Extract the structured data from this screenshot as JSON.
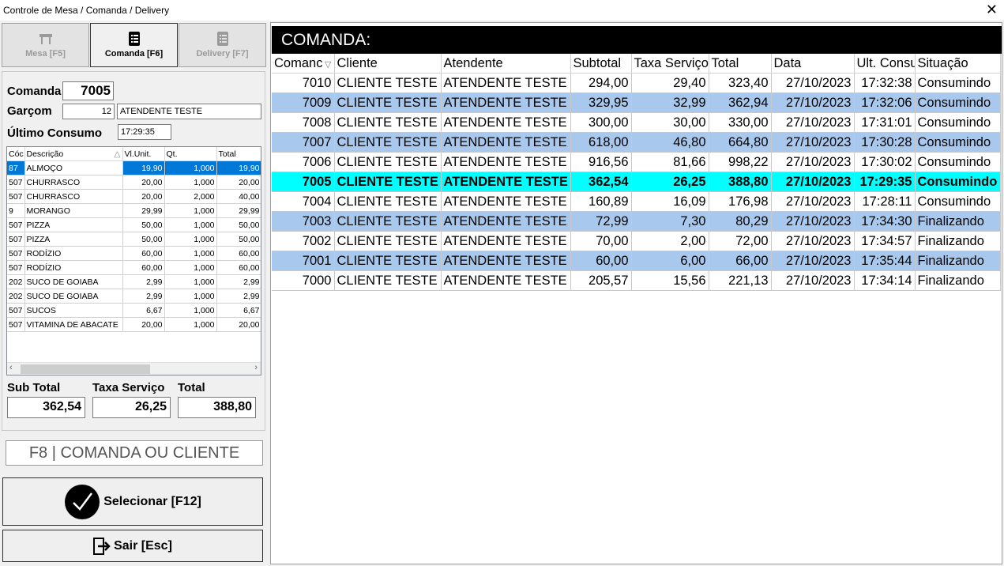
{
  "window": {
    "title": "Controle de Mesa / Comanda / Delivery",
    "close_glyph": "✕"
  },
  "tabs": [
    {
      "label": "Mesa [F5]",
      "icon": "table-icon",
      "active": false
    },
    {
      "label": "Comanda [F6]",
      "icon": "list-icon",
      "active": true
    },
    {
      "label": "Delivery [F7]",
      "icon": "list-icon",
      "active": false
    }
  ],
  "order": {
    "comanda_label": "Comanda",
    "comanda_value": "7005",
    "garcom_label": "Garçom",
    "garcom_code": "12",
    "garcom_name": "ATENDENTE TESTE",
    "ultimo_label": "Último Consumo",
    "ultimo_value": "17:29:35"
  },
  "items_grid": {
    "headers": {
      "code": "Cóc",
      "desc": "Descrição",
      "sort_glyph": "△",
      "unit": "Vl.Unit.",
      "qty": "Qt.",
      "total": "Total"
    },
    "rows": [
      {
        "code": "87",
        "desc": "ALMOÇO",
        "unit": "19,90",
        "qty": "1,000",
        "total": "19,90"
      },
      {
        "code": "507",
        "desc": "CHURRASCO",
        "unit": "20,00",
        "qty": "1,000",
        "total": "20,00"
      },
      {
        "code": "507",
        "desc": "CHURRASCO",
        "unit": "20,00",
        "qty": "2,000",
        "total": "40,00"
      },
      {
        "code": "9",
        "desc": "MORANGO",
        "unit": "29,99",
        "qty": "1,000",
        "total": "29,99"
      },
      {
        "code": "507",
        "desc": "PIZZA",
        "unit": "50,00",
        "qty": "1,000",
        "total": "50,00"
      },
      {
        "code": "507",
        "desc": "PIZZA",
        "unit": "50,00",
        "qty": "1,000",
        "total": "50,00"
      },
      {
        "code": "507",
        "desc": "RODÍZIO",
        "unit": "60,00",
        "qty": "1,000",
        "total": "60,00"
      },
      {
        "code": "507",
        "desc": "RODÍZIO",
        "unit": "60,00",
        "qty": "1,000",
        "total": "60,00"
      },
      {
        "code": "202",
        "desc": "SUCO DE GOIABA",
        "unit": "2,99",
        "qty": "1,000",
        "total": "2,99"
      },
      {
        "code": "202",
        "desc": "SUCO DE GOIABA",
        "unit": "2,99",
        "qty": "1,000",
        "total": "2,99"
      },
      {
        "code": "507",
        "desc": "SUCOS",
        "unit": "6,67",
        "qty": "1,000",
        "total": "6,67"
      },
      {
        "code": "507",
        "desc": "VITAMINA DE ABACATE",
        "unit": "20,00",
        "qty": "1,000",
        "total": "20,00"
      }
    ],
    "scroll_left": "‹",
    "scroll_right": "›"
  },
  "totals": {
    "subtotal_label": "Sub Total",
    "subtotal_value": "362,54",
    "taxa_label": "Taxa Serviço",
    "taxa_value": "26,25",
    "total_label": "Total",
    "total_value": "388,80"
  },
  "search": {
    "label": "F8 | COMANDA OU CLIENTE"
  },
  "buttons": {
    "select_label": "Selecionar [F12]",
    "exit_label": "Sair [Esc]"
  },
  "comandas": {
    "header_title": "COMANDA:",
    "columns": [
      "Comanc",
      "Cliente",
      "Atendente",
      "Subtotal",
      "Taxa Serviço",
      "Total",
      "Data",
      "Ult. Consu",
      "Situação"
    ],
    "sort_glyph": "▽",
    "highlight_color": "#00ffff",
    "alt_row_color": "#a8c8ee",
    "rows": [
      {
        "num": "7010",
        "cliente": "CLIENTE TESTE",
        "atendente": "ATENDENTE TESTE",
        "subtotal": "294,00",
        "taxa": "29,40",
        "total": "323,40",
        "data": "27/10/2023",
        "ult": "17:32:38",
        "situacao": "Consumindo"
      },
      {
        "num": "7009",
        "cliente": "CLIENTE TESTE",
        "atendente": "ATENDENTE TESTE",
        "subtotal": "329,95",
        "taxa": "32,99",
        "total": "362,94",
        "data": "27/10/2023",
        "ult": "17:32:06",
        "situacao": "Consumindo"
      },
      {
        "num": "7008",
        "cliente": "CLIENTE TESTE",
        "atendente": "ATENDENTE TESTE",
        "subtotal": "300,00",
        "taxa": "30,00",
        "total": "330,00",
        "data": "27/10/2023",
        "ult": "17:31:01",
        "situacao": "Consumindo"
      },
      {
        "num": "7007",
        "cliente": "CLIENTE TESTE",
        "atendente": "ATENDENTE TESTE",
        "subtotal": "618,00",
        "taxa": "46,80",
        "total": "664,80",
        "data": "27/10/2023",
        "ult": "17:30:28",
        "situacao": "Consumindo"
      },
      {
        "num": "7006",
        "cliente": "CLIENTE TESTE",
        "atendente": "ATENDENTE TESTE",
        "subtotal": "916,56",
        "taxa": "81,66",
        "total": "998,22",
        "data": "27/10/2023",
        "ult": "17:30:02",
        "situacao": "Consumindo"
      },
      {
        "num": "7005",
        "cliente": "CLIENTE TESTE",
        "atendente": "ATENDENTE TESTE",
        "subtotal": "362,54",
        "taxa": "26,25",
        "total": "388,80",
        "data": "27/10/2023",
        "ult": "17:29:35",
        "situacao": "Consumindo"
      },
      {
        "num": "7004",
        "cliente": "CLIENTE TESTE",
        "atendente": "ATENDENTE TESTE",
        "subtotal": "160,89",
        "taxa": "16,09",
        "total": "176,98",
        "data": "27/10/2023",
        "ult": "17:28:11",
        "situacao": "Consumindo"
      },
      {
        "num": "7003",
        "cliente": "CLIENTE TESTE",
        "atendente": "ATENDENTE TESTE",
        "subtotal": "72,99",
        "taxa": "7,30",
        "total": "80,29",
        "data": "27/10/2023",
        "ult": "17:34:30",
        "situacao": "Finalizando"
      },
      {
        "num": "7002",
        "cliente": "CLIENTE TESTE",
        "atendente": "ATENDENTE TESTE",
        "subtotal": "70,00",
        "taxa": "2,00",
        "total": "72,00",
        "data": "27/10/2023",
        "ult": "17:34:57",
        "situacao": "Finalizando"
      },
      {
        "num": "7001",
        "cliente": "CLIENTE TESTE",
        "atendente": "ATENDENTE TESTE",
        "subtotal": "60,00",
        "taxa": "6,00",
        "total": "66,00",
        "data": "27/10/2023",
        "ult": "17:35:44",
        "situacao": "Finalizando"
      },
      {
        "num": "7000",
        "cliente": "CLIENTE TESTE",
        "atendente": "ATENDENTE TESTE",
        "subtotal": "205,57",
        "taxa": "15,56",
        "total": "221,13",
        "data": "27/10/2023",
        "ult": "17:34:14",
        "situacao": "Finalizando"
      }
    ]
  }
}
